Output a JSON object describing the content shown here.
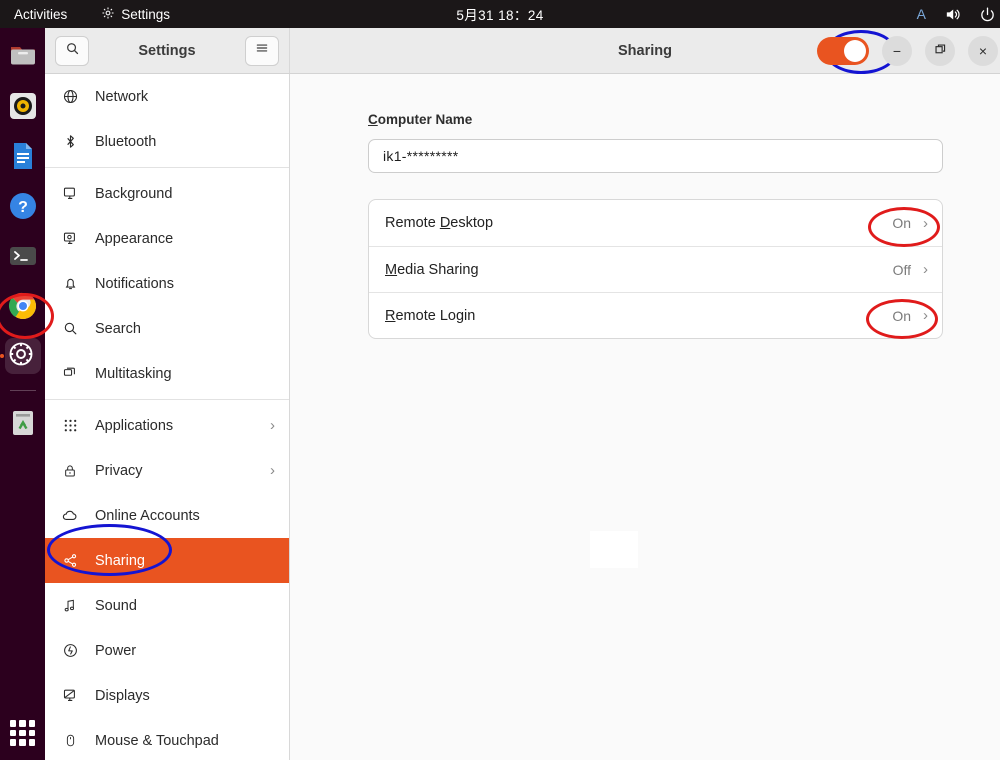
{
  "topbar": {
    "activities": "Activities",
    "app_name": "Settings",
    "app_icon": "gear-icon",
    "clock": "5月31 18：24",
    "input_method": "A",
    "volume_icon": "volume-icon",
    "power_icon": "power-icon"
  },
  "dock": {
    "items": [
      {
        "name": "files",
        "icon": "files-folder-icon"
      },
      {
        "name": "rhythmbox",
        "icon": "rhythmbox-icon"
      },
      {
        "name": "libreoffice-writer",
        "icon": "document-icon"
      },
      {
        "name": "help",
        "icon": "help-question-icon"
      },
      {
        "name": "terminal",
        "icon": "terminal-icon"
      },
      {
        "name": "chrome",
        "icon": "chrome-icon"
      },
      {
        "name": "settings",
        "icon": "gear-icon",
        "active": true
      },
      {
        "name": "trash",
        "icon": "trash-recycle-icon"
      }
    ],
    "show_apps": "show-applications-grid-icon"
  },
  "window": {
    "sidebar_header": {
      "search_icon": "search-icon",
      "title": "Settings",
      "menu_icon": "hamburger-menu-icon"
    },
    "page_title": "Sharing",
    "master_switch": {
      "state": "on",
      "color": "#e95420"
    },
    "controls": {
      "minimize": "−",
      "maximize": "restore-icon",
      "close": "×"
    }
  },
  "sidebar": {
    "groups": [
      {
        "items": [
          {
            "label": "Network",
            "icon": "globe-icon"
          },
          {
            "label": "Bluetooth",
            "icon": "bluetooth-icon"
          }
        ]
      },
      {
        "items": [
          {
            "label": "Background",
            "icon": "background-monitor-icon"
          },
          {
            "label": "Appearance",
            "icon": "appearance-icon"
          },
          {
            "label": "Notifications",
            "icon": "bell-icon"
          },
          {
            "label": "Search",
            "icon": "search-icon"
          },
          {
            "label": "Multitasking",
            "icon": "multitasking-windows-icon"
          }
        ]
      },
      {
        "items": [
          {
            "label": "Applications",
            "icon": "app-grid-icon",
            "chevron": "›"
          },
          {
            "label": "Privacy",
            "icon": "lock-icon",
            "chevron": "›"
          },
          {
            "label": "Online Accounts",
            "icon": "cloud-icon"
          },
          {
            "label": "Sharing",
            "icon": "share-nodes-icon",
            "selected": true
          },
          {
            "label": "Sound",
            "icon": "music-note-icon"
          },
          {
            "label": "Power",
            "icon": "power-circle-icon"
          },
          {
            "label": "Displays",
            "icon": "display-monitor-icon"
          },
          {
            "label": "Mouse & Touchpad",
            "icon": "mouse-icon"
          }
        ]
      }
    ]
  },
  "main": {
    "computer_name": {
      "label_prefix": "",
      "label_mnemonic": "C",
      "label_rest": "omputer Name",
      "value": "ik1-*********"
    },
    "rows": [
      {
        "label_prefix": "Remote ",
        "label_mnemonic": "D",
        "label_rest": "esktop",
        "state": "On",
        "chevron": "›",
        "highlighted": true
      },
      {
        "label_prefix": "",
        "label_mnemonic": "M",
        "label_rest": "edia Sharing",
        "state": "Off",
        "chevron": "›",
        "highlighted": false
      },
      {
        "label_prefix": "",
        "label_mnemonic": "R",
        "label_rest": "emote Login",
        "state": "On",
        "chevron": "›",
        "highlighted": true
      }
    ]
  },
  "annotations": {
    "blue_color": "#1414d2",
    "red_color": "#e01b1b",
    "items": [
      {
        "name": "annotation-ellipse-master-switch",
        "shape": "ellipse",
        "color": "blue"
      },
      {
        "name": "annotation-ellipse-sidebar-sharing",
        "shape": "ellipse",
        "color": "blue"
      },
      {
        "name": "annotation-ellipse-remote-desktop-on",
        "shape": "ellipse",
        "color": "red"
      },
      {
        "name": "annotation-ellipse-remote-login-on",
        "shape": "ellipse",
        "color": "red"
      },
      {
        "name": "annotation-ellipse-dock-settings",
        "shape": "ellipse",
        "color": "red"
      }
    ]
  }
}
